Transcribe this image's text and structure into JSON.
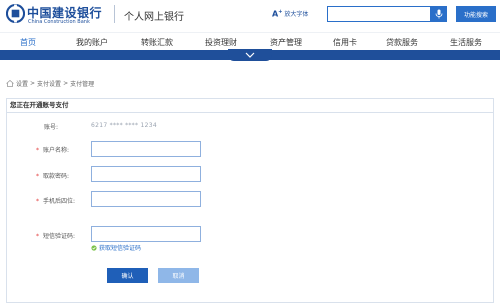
{
  "header": {
    "logo_cn": "中国建设银行",
    "logo_en": "China Construction Bank",
    "subtitle": "个人网上银行",
    "font_button": "放大字体",
    "search_placeholder": "",
    "search_button": "功能搜索"
  },
  "nav": {
    "items": [
      {
        "label": "首页",
        "active": true
      },
      {
        "label": "我的账户",
        "active": false
      },
      {
        "label": "转账汇款",
        "active": false
      },
      {
        "label": "投资理财",
        "active": false
      },
      {
        "label": "资产管理",
        "active": false
      },
      {
        "label": "信用卡",
        "active": false
      },
      {
        "label": "贷款服务",
        "active": false
      },
      {
        "label": "生活服务",
        "active": false
      }
    ]
  },
  "breadcrumb": {
    "items": [
      "设置",
      "支付设置",
      "支付管理"
    ],
    "separator": ">"
  },
  "panel": {
    "title": "您正在开通账号支付",
    "account_label": "账号:",
    "account_value": "6217 **** **** 1234",
    "name_label": "账户名称:",
    "password_label": "取款密码:",
    "phone_label": "手机后四位:",
    "sms_label": "短信验证码:",
    "sms_link": "获取短信验证码",
    "confirm": "确认",
    "cancel": "取消",
    "required_mark": "*"
  },
  "colors": {
    "brand": "#1d4e9b",
    "accent": "#2a6fc9",
    "nav_bar": "#1f4f9a",
    "required": "#e23b3b"
  }
}
